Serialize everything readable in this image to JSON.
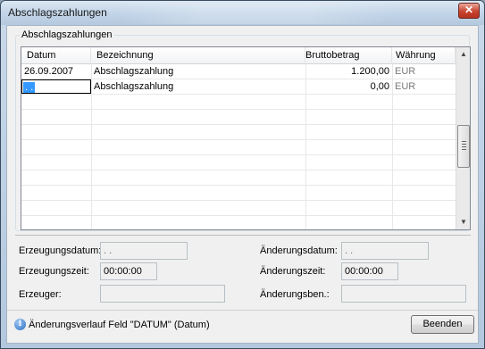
{
  "window": {
    "title": "Abschlagszahlungen",
    "close_glyph": "✕"
  },
  "group": {
    "legend": "Abschlagszahlungen"
  },
  "table": {
    "columns": [
      "Datum",
      "Bezeichnung",
      "Bruttobetrag",
      "Währung"
    ],
    "rows": [
      {
        "datum": "26.09.2007",
        "bezeichnung": "Abschlagszahlung",
        "betrag": "1.200,00",
        "waehrung": "EUR"
      },
      {
        "datum": ". .",
        "bezeichnung": "Abschlagszahlung",
        "betrag": "0,00",
        "waehrung": "EUR"
      }
    ]
  },
  "scrollbar": {
    "up_glyph": "▲",
    "down_glyph": "▼"
  },
  "fields": {
    "erzeugungsdatum": {
      "label": "Erzeugungsdatum:",
      "value": ". ."
    },
    "erzeugungszeit": {
      "label": "Erzeugungszeit:",
      "value": "00:00:00"
    },
    "erzeuger": {
      "label": "Erzeuger:",
      "value": ""
    },
    "aenderungsdatum": {
      "label": "Änderungsdatum:",
      "value": ". ."
    },
    "aenderungszeit": {
      "label": "Änderungszeit:",
      "value": "00:00:00"
    },
    "aenderungsben": {
      "label": "Änderungsben.:",
      "value": ""
    }
  },
  "footer": {
    "info_icon": "info-icon",
    "info_glyph": "i",
    "info_text": "Änderungsverlauf Feld \"DATUM\" (Datum)",
    "button_label": "Beenden"
  },
  "colors": {
    "selection": "#3399ff",
    "close_button": "#c9432f"
  }
}
